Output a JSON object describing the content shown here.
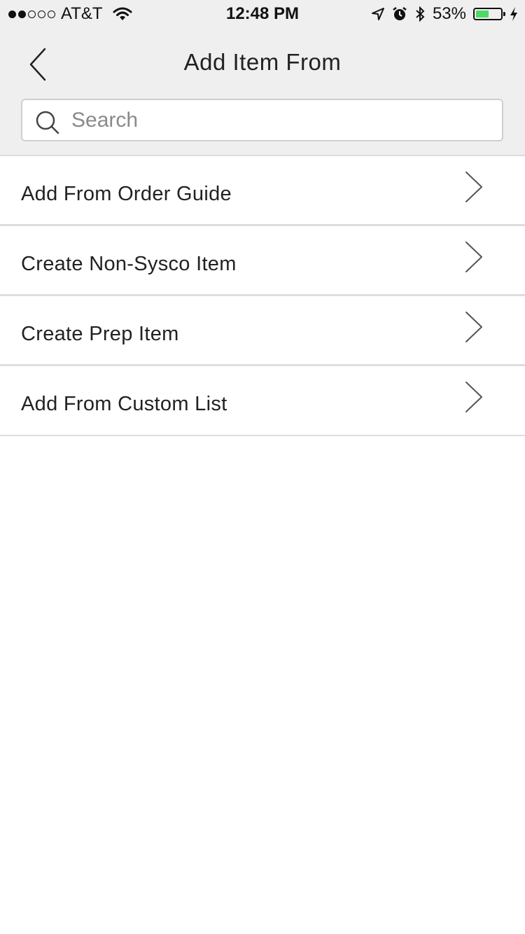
{
  "status_bar": {
    "carrier": "AT&T",
    "signal_bars_filled": 2,
    "signal_bars_total": 5,
    "time": "12:48 PM",
    "battery_percent": "53%",
    "battery_level": 0.53,
    "battery_color": "#4cd964",
    "icons": [
      "wifi-icon",
      "location-arrow-icon",
      "alarm-icon",
      "bluetooth-icon",
      "battery-icon",
      "charging-bolt-icon"
    ]
  },
  "header": {
    "title": "Add Item From",
    "back_icon": "chevron-left-icon"
  },
  "search": {
    "placeholder": "Search",
    "value": ""
  },
  "menu": {
    "items": [
      {
        "label": "Add From Order Guide"
      },
      {
        "label": "Create Non-Sysco Item"
      },
      {
        "label": "Create Prep Item"
      },
      {
        "label": "Add From Custom List"
      }
    ]
  }
}
